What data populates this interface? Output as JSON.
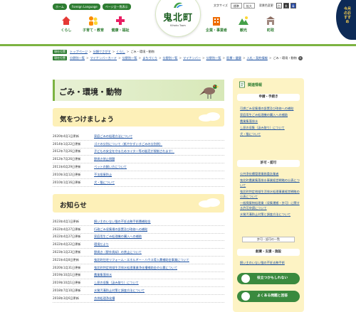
{
  "header": {
    "top_buttons": [
      "ホーム",
      "Foreign Language",
      "ページ全一覧表示"
    ],
    "logo_title": "鬼北町",
    "logo_sub": "Kihoku Town",
    "util_label_text_size": "文字サイズ",
    "util_btn_standard": "標準",
    "util_btn_large": "拡大",
    "util_label_bg": "背景色変更",
    "util_colors": [
      "白",
      "黒",
      "青"
    ],
    "corner_text": "今月のおすすめ",
    "brand_color": "#2e7d32"
  },
  "nav": {
    "left": [
      {
        "label": "くらし",
        "icon": "house-icon"
      },
      {
        "label": "子育て・教育",
        "icon": "family-icon"
      },
      {
        "label": "健康・福祉",
        "icon": "health-icon"
      }
    ],
    "right": [
      {
        "label": "企業・事業者",
        "icon": "building-icon"
      },
      {
        "label": "観光",
        "icon": "tourism-icon"
      },
      {
        "label": "町政",
        "icon": "townhall-icon"
      }
    ]
  },
  "breadcrumb": {
    "row1_tag": "現在位置",
    "row1": [
      "トップページ",
      "分類でさがす",
      "くらし",
      "ごみ・環境・動物"
    ],
    "row2_tag": "現在位置",
    "row2": [
      "分野別一覧",
      "マイナンバーカード",
      "分野別一覧",
      "まちづくり",
      "分野別一覧",
      "マイナンバー",
      "分野別一覧",
      "医療・健康",
      "入札・契約情報",
      "ごみ・環境・動物"
    ]
  },
  "main": {
    "page_title": "ごみ・環境・動物",
    "section1_title": "気をつけましょう",
    "section1_items": [
      {
        "date": "2020年4月1日更新",
        "text": "家庭ごみの処理方法について"
      },
      {
        "date": "2014年1月22日更新",
        "text": "ゴミの分別について（紙やかずいすごみの分別例）"
      },
      {
        "date": "2012年7月26日更新",
        "text": "子どもの安全を守るためライター等の販売が規制されます！"
      },
      {
        "date": "2012年7月26日更新",
        "text": "野焼き禁止問題"
      },
      {
        "date": "2011年6月29日更新",
        "text": "ペットの飼い方について"
      },
      {
        "date": "2010年3月12日更新",
        "text": "不法投棄防止"
      },
      {
        "date": "2010年1月16日更新",
        "text": "犬・猫について"
      }
    ],
    "section2_title": "お知らせ",
    "section2_items": [
      {
        "date": "2023年4月1日更新",
        "text": "飼い主のいない猫の不妊去勢手術費補助金"
      },
      {
        "date": "2022年4月27日更新",
        "text": "行政ごみ収集場の設置及び改修への補助"
      },
      {
        "date": "2022年4月27日更新",
        "text": "家庭用生ごみ処理機の購入への補助"
      },
      {
        "date": "2022年4月22日更新",
        "text": "環境だより"
      },
      {
        "date": "2023年1月23日更新",
        "text": "野焼き（野外焼却）の禁止について"
      },
      {
        "date": "2021年4月8日更新",
        "text": "鬼北町住宅リフォーム・エネルギー・ハウス導入費補助金事業について"
      },
      {
        "date": "2020年1月31日更新",
        "text": "鬼北町特定地域生活排水処理事業浄化槽補助金の公募について"
      },
      {
        "date": "2019年10月1日更新",
        "text": "農業集落排水"
      },
      {
        "date": "2019年10月1日更新",
        "text": "し尿の収集（汲み取り）について"
      },
      {
        "date": "2018年7月10日更新",
        "text": "水質汚濁防止対策と調査方法について"
      },
      {
        "date": "2018年3月6日更新",
        "text": "合併処理浄化槽"
      }
    ]
  },
  "sidebar": {
    "head": "関連情報",
    "sub1": "申請・手続き",
    "list1": [
      "可燃ごみ収集場の設置及び改修への補助",
      "家庭用生ごみ処理機の購入への補助",
      "農業集落排水",
      "し尿の収集（汲み取り）について",
      "犬・猫について"
    ],
    "sub2": "許可・認可",
    "list2": [
      "公共浄化槽管理業務委託業者",
      "鬼北町農業集落排水事業経営戦略の公表について",
      "鬼北町特定地域生活排水処理事業経営戦略の公表について",
      "一般廃棄物処理業（収集運搬・許可）に関する許可申請について",
      "水質汚濁防止対策と調査方法について"
    ],
    "more_label": "許可・認可の一覧",
    "sub3": "創業・支援・施設",
    "list3": [
      "飼い主のいない猫の不妊去勢手術"
    ],
    "green1": "役立つかもしれない",
    "green2": "よくある問題と回答"
  }
}
